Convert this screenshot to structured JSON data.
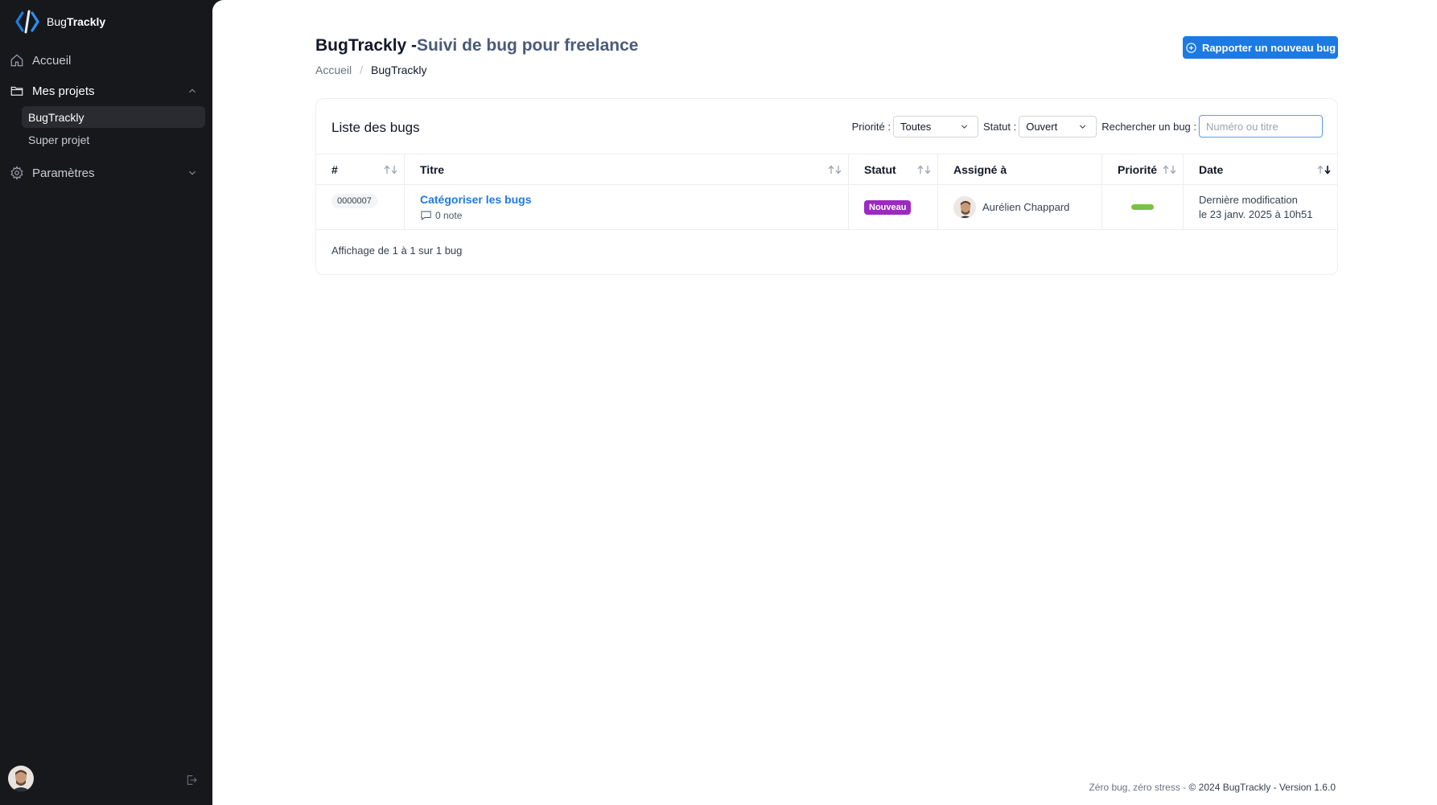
{
  "app": {
    "name_prefix": "Bug",
    "name_bold": "Trackly"
  },
  "sidebar": {
    "home": "Accueil",
    "projects": "Mes projets",
    "project_items": [
      {
        "label": "BugTrackly",
        "active": true
      },
      {
        "label": "Super projet",
        "active": false
      }
    ],
    "settings": "Paramètres"
  },
  "header": {
    "title": "BugTrackly -",
    "subtitle": "Suivi de bug pour freelance",
    "breadcrumb": [
      "Accueil",
      "BugTrackly"
    ],
    "new_bug_label": "Rapporter un nouveau bug"
  },
  "list": {
    "title": "Liste des bugs",
    "filters": {
      "priority_label": "Priorité :",
      "priority_value": "Toutes",
      "status_label": "Statut :",
      "status_value": "Ouvert",
      "search_label": "Rechercher un bug :",
      "search_placeholder": "Numéro ou titre"
    },
    "columns": [
      "#",
      "Titre",
      "Statut",
      "Assigné à",
      "Priorité",
      "Date"
    ],
    "rows": [
      {
        "id": "0000007",
        "title": "Catégoriser les bugs",
        "notes": "0 note",
        "status": "Nouveau",
        "assignee": "Aurélien Chappard",
        "date_line1": "Dernière modification",
        "date_line2": "le 23 janv. 2025 à 10h51"
      }
    ],
    "summary": "Affichage de 1 à 1 sur 1 bug"
  },
  "footer": {
    "tagline": "Zéro bug, zéro stress - ",
    "copyright": "© 2024 BugTrackly - Version 1.6.0"
  },
  "colors": {
    "accent": "#1d7ae3",
    "status_new": "#9b2bc0",
    "priority_low": "#7ac143",
    "sidebar_bg": "#17181c"
  }
}
